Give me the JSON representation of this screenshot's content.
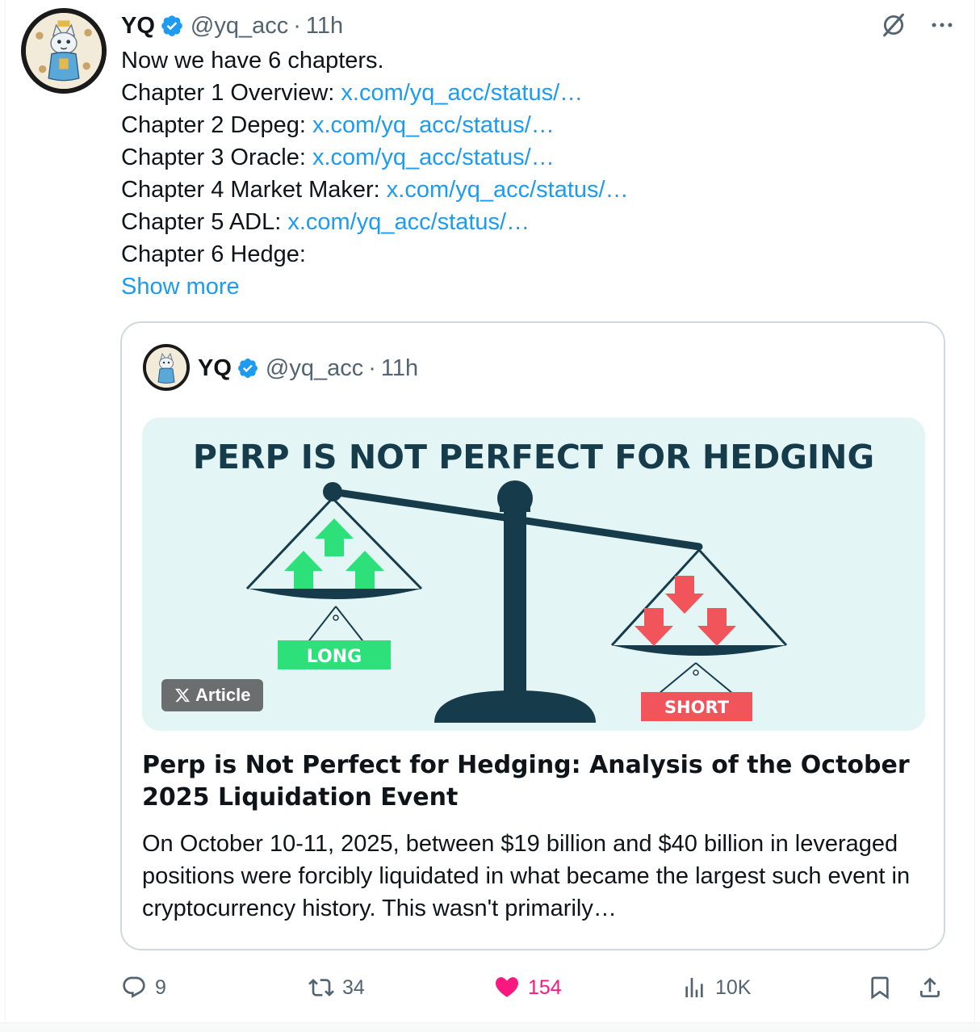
{
  "tweet": {
    "name": "YQ",
    "handle": "@yq_acc",
    "dot": "·",
    "time": "11h",
    "lines": [
      {
        "prefix": "Now we have 6 chapters.",
        "link": ""
      },
      {
        "prefix": "Chapter 1 Overview: ",
        "link": "x.com/yq_acc/status/…"
      },
      {
        "prefix": "Chapter 2 Depeg: ",
        "link": "x.com/yq_acc/status/…"
      },
      {
        "prefix": "Chapter 3 Oracle: ",
        "link": "x.com/yq_acc/status/…"
      },
      {
        "prefix": "Chapter 4 Market Maker: ",
        "link": "x.com/yq_acc/status/…"
      },
      {
        "prefix": "Chapter 5 ADL: ",
        "link": "x.com/yq_acc/status/…"
      },
      {
        "prefix": "Chapter 6 Hedge:",
        "link": ""
      }
    ],
    "show_more": "Show more"
  },
  "quote": {
    "name": "YQ",
    "handle": "@yq_acc",
    "dot": "·",
    "time": "11h",
    "image": {
      "headline": "PERP IS NOT PERFECT FOR HEDGING",
      "long_label": "LONG",
      "short_label": "SHORT",
      "long_color": "#2ee07a",
      "short_color": "#f2545b",
      "beam_color": "#163c4c"
    },
    "badge_label": "Article",
    "title": "Perp is Not Perfect for Hedging: Analysis of the October 2025 Liquidation Event",
    "body": "On October 10-11, 2025, between $19 billion and $40 billion in leveraged positions were forcibly liquidated in what became the largest such event in cryptocurrency history. This wasn't primarily…"
  },
  "actions": {
    "replies": "9",
    "reposts": "34",
    "likes": "154",
    "views": "10K",
    "like_color": "#f91880"
  },
  "icons": [
    "verified-badge-icon",
    "grok-icon",
    "more-icon",
    "x-logo-icon",
    "reply-icon",
    "repost-icon",
    "like-icon",
    "views-icon",
    "bookmark-icon",
    "share-icon"
  ]
}
